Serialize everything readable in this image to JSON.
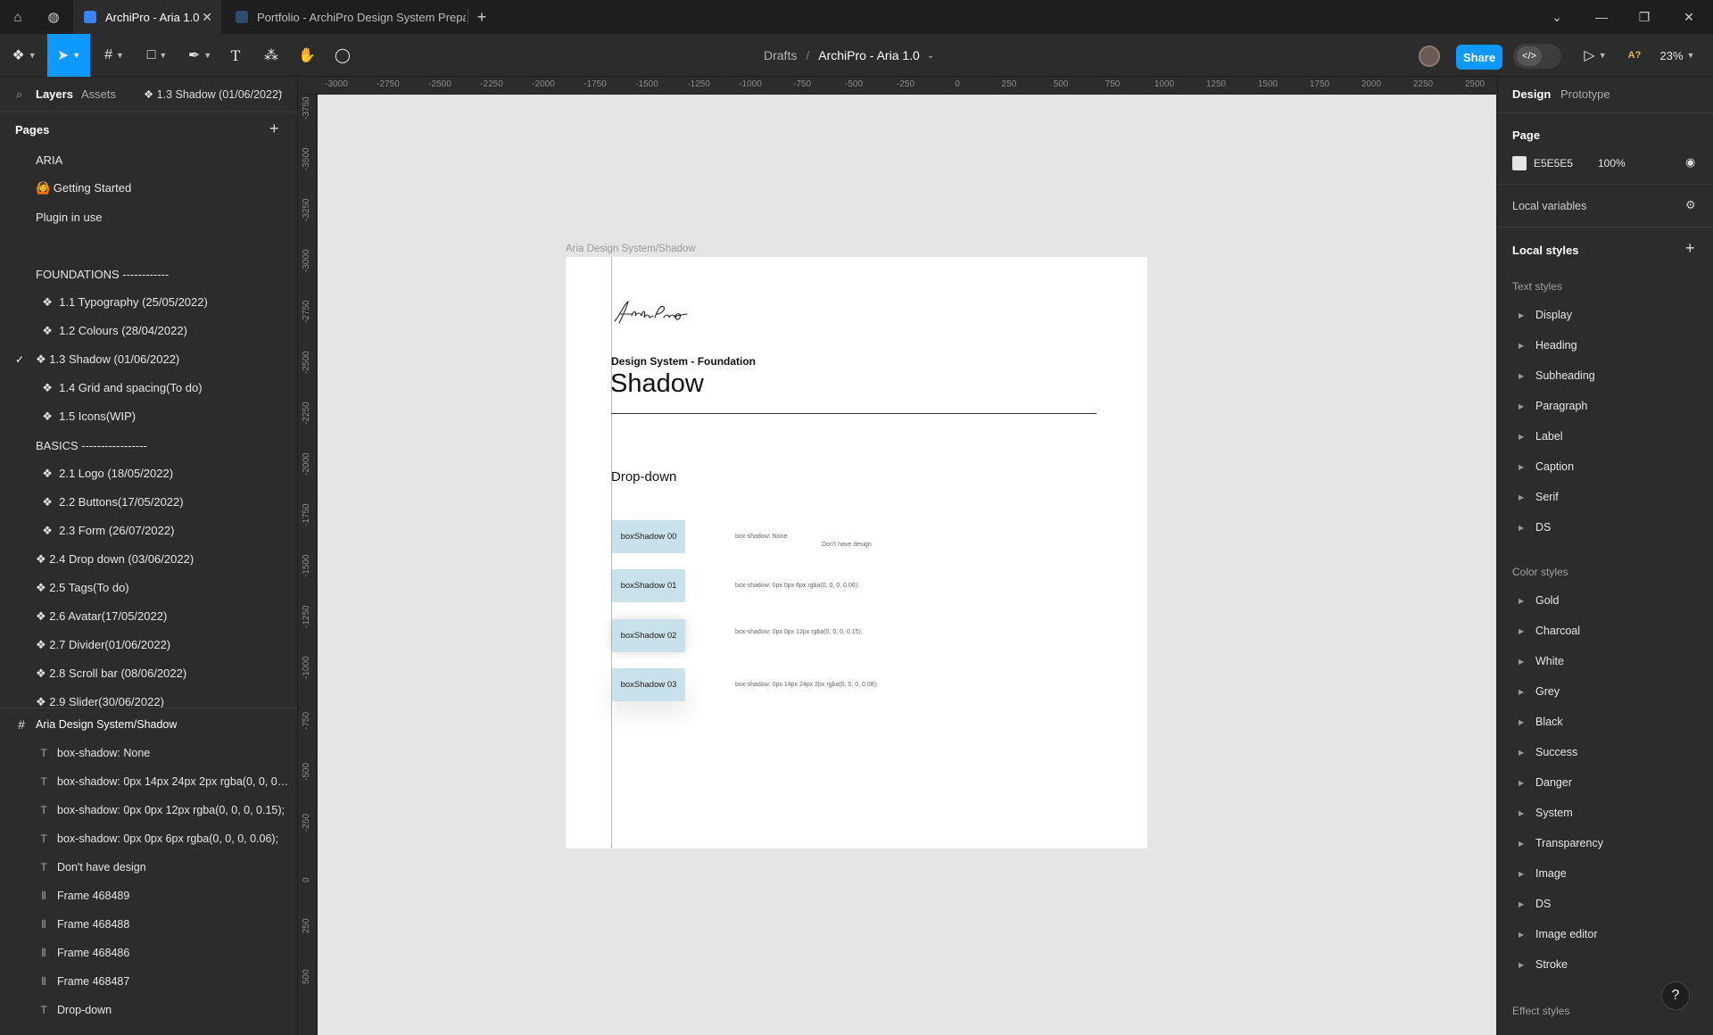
{
  "browser": {
    "tabs": [
      {
        "title": "ArchiPro - Aria 1.0",
        "active": true
      },
      {
        "title": "Portfolio - ArchiPro Design System Prepar",
        "active": false
      }
    ],
    "new_tab_label": "+"
  },
  "toolbar": {
    "breadcrumb_root": "Drafts",
    "breadcrumb_sep": "/",
    "file_name": "ArchiPro - Aria 1.0",
    "share_label": "Share",
    "zoom": "23%",
    "user_badge": "A?"
  },
  "left": {
    "tab_layers": "Layers",
    "tab_assets": "Assets",
    "current_page": "❖ 1.3 Shadow (01/06/2022)",
    "pages_header": "Pages",
    "add_label": "+",
    "pages": [
      {
        "label": "ARIA",
        "checked": false
      },
      {
        "label": "🙆 Getting Started",
        "checked": false
      },
      {
        "label": "Plugin in use",
        "checked": false
      },
      {
        "label": "",
        "checked": false
      },
      {
        "label": "FOUNDATIONS ------------",
        "checked": false
      },
      {
        "label": "  ❖  1.1 Typography (25/05/2022)",
        "checked": false
      },
      {
        "label": "  ❖  1.2 Colours (28/04/2022)",
        "checked": false
      },
      {
        "label": "❖ 1.3 Shadow (01/06/2022)",
        "checked": true
      },
      {
        "label": "  ❖  1.4 Grid and spacing(To do)",
        "checked": false
      },
      {
        "label": "  ❖  1.5 Icons(WIP)",
        "checked": false
      },
      {
        "label": "BASICS -----------------",
        "checked": false
      },
      {
        "label": "  ❖  2.1 Logo (18/05/2022)",
        "checked": false
      },
      {
        "label": "  ❖  2.2 Buttons(17/05/2022)",
        "checked": false
      },
      {
        "label": "  ❖  2.3 Form (26/07/2022)",
        "checked": false
      },
      {
        "label": "❖ 2.4 Drop down (03/06/2022)",
        "checked": false
      },
      {
        "label": "❖ 2.5 Tags(To do)",
        "checked": false
      },
      {
        "label": "❖ 2.6 Avatar(17/05/2022)",
        "checked": false
      },
      {
        "label": "❖ 2.7 Divider(01/06/2022)",
        "checked": false
      },
      {
        "label": "❖ 2.8 Scroll bar (08/06/2022)",
        "checked": false
      },
      {
        "label": "❖ 2.9 Slider(30/06/2022)",
        "checked": false
      }
    ],
    "frame_name": "Aria Design System/Shadow",
    "layers": [
      {
        "label": "box-shadow: None",
        "kind": "text"
      },
      {
        "label": "box-shadow: 0px 14px 24px 2px rgba(0, 0, 0, 0....",
        "kind": "text"
      },
      {
        "label": "box-shadow: 0px 0px 12px rgba(0, 0, 0, 0.15);",
        "kind": "text"
      },
      {
        "label": "box-shadow: 0px 0px 6px rgba(0, 0, 0, 0.06);",
        "kind": "text"
      },
      {
        "label": "Don't have design",
        "kind": "text"
      },
      {
        "label": "Frame 468489",
        "kind": "frame"
      },
      {
        "label": "Frame 468488",
        "kind": "frame"
      },
      {
        "label": "Frame 468486",
        "kind": "frame"
      },
      {
        "label": "Frame 468487",
        "kind": "frame"
      },
      {
        "label": "Drop-down",
        "kind": "text"
      }
    ]
  },
  "rulers": {
    "top": [
      "-3000",
      "-2750",
      "-2500",
      "-2250",
      "-2000",
      "-1750",
      "-1500",
      "-1250",
      "-1000",
      "-750",
      "-500",
      "-250",
      "0",
      "250",
      "500",
      "750",
      "1000",
      "1250",
      "1500",
      "1750",
      "2000",
      "2250",
      "2500"
    ],
    "left": [
      "-3750",
      "-3500",
      "-3250",
      "-3000",
      "-2750",
      "-2500",
      "-2250",
      "-2000",
      "-1750",
      "-1500",
      "-1250",
      "-1000",
      "-750",
      "-500",
      "-250",
      "0",
      "250",
      "500"
    ]
  },
  "canvas": {
    "frame_label": "Aria Design System/Shadow",
    "signature": "ArchiPro",
    "subtitle": "Design System - Foundation",
    "title": "Shadow",
    "section": "Drop-down",
    "boxes": [
      {
        "label": "boxShadow 00",
        "note": "box-shadow: None",
        "shadow": "none"
      },
      {
        "label": "boxShadow 01",
        "note": "box-shadow: 0px 0px 6px rgba(0, 0, 0, 0.06);",
        "shadow": "0px 0px 6px rgba(0,0,0,0.06)"
      },
      {
        "label": "boxShadow 02",
        "note": "box-shadow: 0px 0px 12px rgba(0, 0, 0, 0.15);",
        "shadow": "0px 0px 12px rgba(0,0,0,0.15)"
      },
      {
        "label": "boxShadow 03",
        "note": "box-shadow: 0px 14px 24px 2px rgba(0, 0, 0, 0.08);",
        "shadow": "0px 14px 24px 2px rgba(0,0,0,0.08)"
      }
    ],
    "no_design_note": "Don't have design"
  },
  "right": {
    "tab_design": "Design",
    "tab_prototype": "Prototype",
    "page_header": "Page",
    "page_color": "E5E5E5",
    "page_opacity": "100%",
    "local_variables": "Local variables",
    "local_styles": "Local styles",
    "text_styles_header": "Text styles",
    "text_styles": [
      "Display",
      "Heading",
      "Subheading",
      "Paragraph",
      "Label",
      "Caption",
      "Serif",
      "DS"
    ],
    "color_styles_header": "Color styles",
    "color_styles": [
      "Gold",
      "Charcoal",
      "White",
      "Grey",
      "Black",
      "Success",
      "Danger",
      "System",
      "Transparency",
      "Image",
      "DS",
      "Image editor",
      "Stroke"
    ],
    "effect_styles_header": "Effect styles"
  },
  "colors": {
    "accent": "#0d99ff",
    "canvas_bg": "#e5e5e5",
    "swatch_box": "#c8e1ea",
    "guide": "#f1a39a"
  },
  "help_label": "?"
}
